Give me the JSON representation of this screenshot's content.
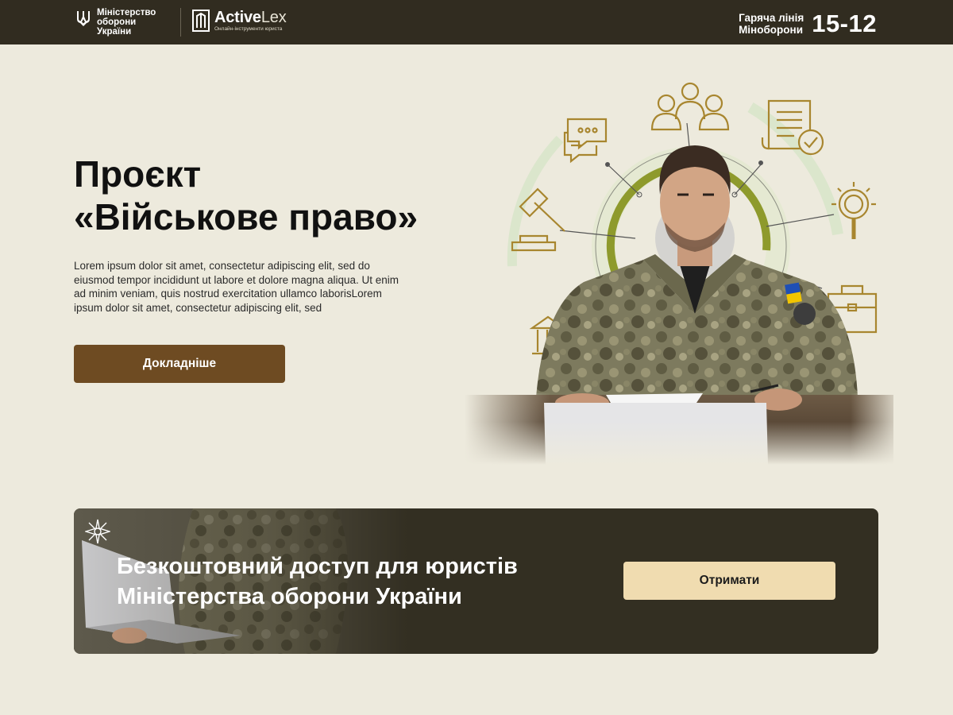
{
  "header": {
    "ministry": {
      "line1": "Міністерство",
      "line2": "оборони",
      "line3": "України"
    },
    "brand": {
      "name_bold": "Active",
      "name_light": "Lex",
      "tagline": "Онлайн-інструменти юриста"
    },
    "hotline": {
      "label_line1": "Гаряча лінія",
      "label_line2": "Міноборони",
      "number": "15-12"
    }
  },
  "hero": {
    "title_line1": "Проєкт",
    "title_line2": "«Військове право»",
    "text": "Lorem ipsum dolor sit amet, consectetur adipiscing elit, sed do eiusmod tempor incididunt ut labore et dolore magna aliqua. Ut enim ad minim veniam, quis nostrud exercitation ullamco laborisLorem ipsum dolor sit amet, consectetur adipiscing elit, sed",
    "button_label": "Докладніше"
  },
  "promo": {
    "title_line1": "Безкоштовний доступ для юристів",
    "title_line2": "Міністерства оборони України",
    "button_label": "Отримати"
  },
  "icons": [
    "trident-icon",
    "activelex-logo-icon",
    "chat-icon",
    "people-icon",
    "document-check-icon",
    "gavel-icon",
    "magnifier-icon",
    "briefcase-icon",
    "courthouse-icon",
    "military-emblem-icon"
  ],
  "colors": {
    "page_bg": "#edeadd",
    "header_bg": "#312c20",
    "primary_button": "#6e4b22",
    "promo_bg": "#332f22",
    "promo_button": "#f0dcb0",
    "icon_gold": "#a8862f",
    "icon_olive": "#8e9a2c"
  }
}
